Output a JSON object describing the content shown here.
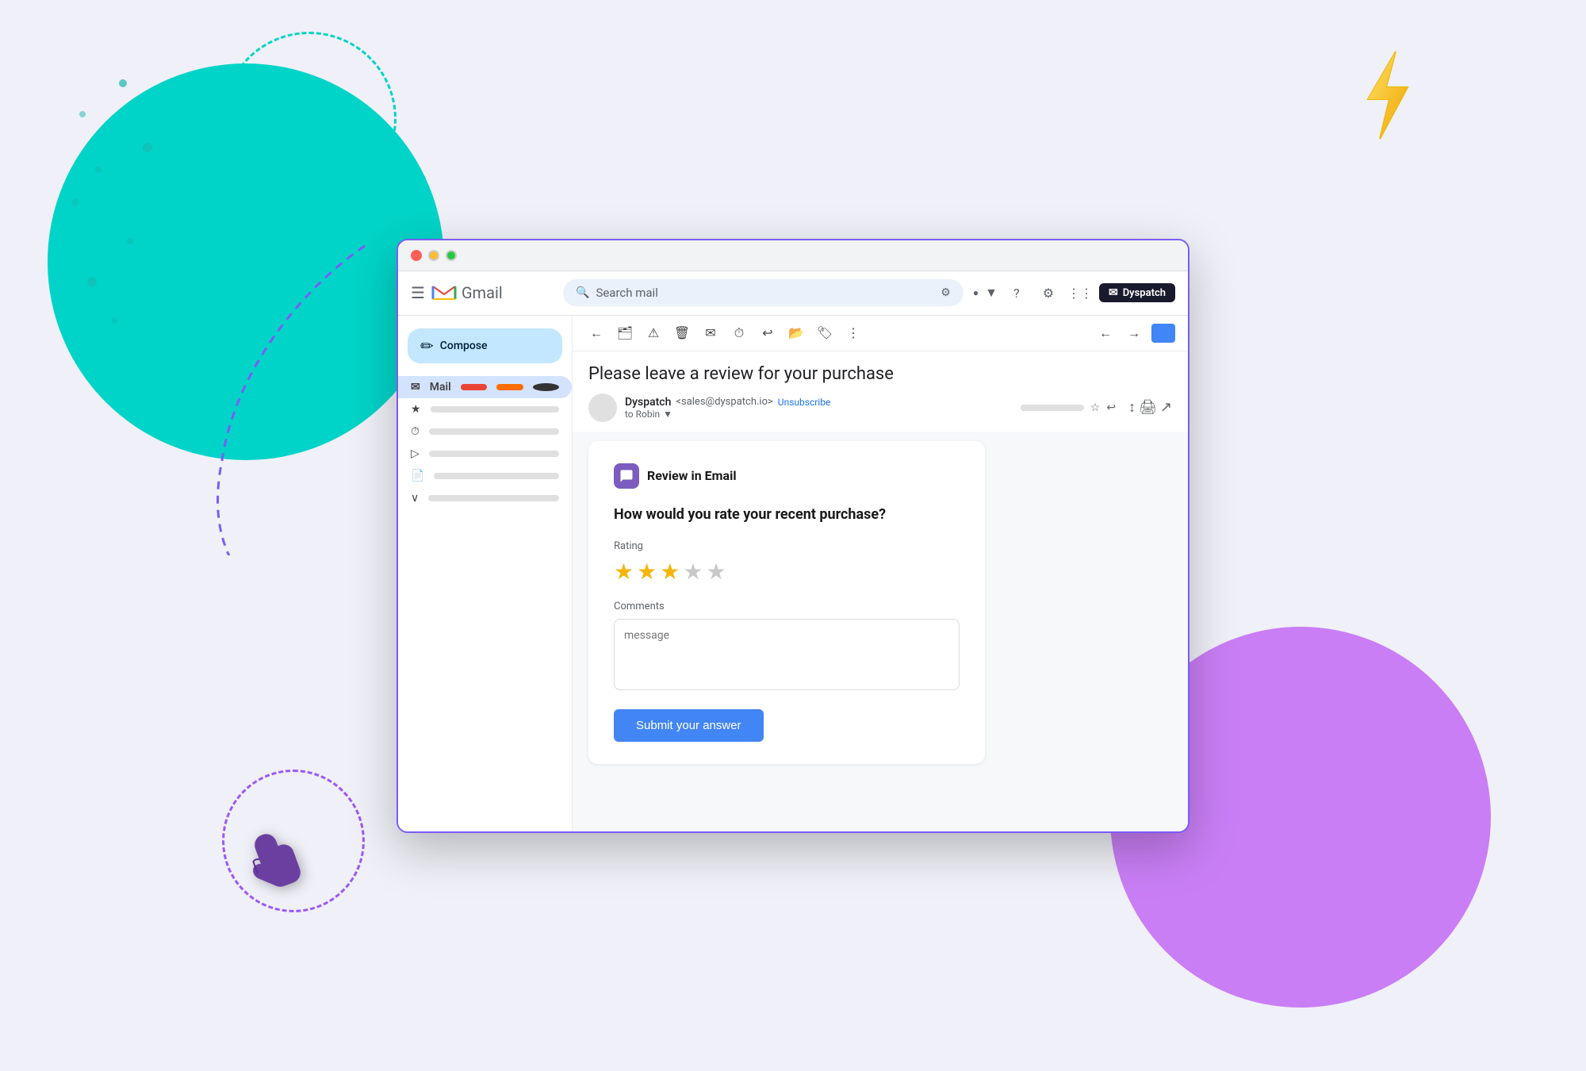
{
  "background": {
    "blob_teal_color": "#00d4c8",
    "blob_purple_color": "#c97ef5"
  },
  "browser": {
    "traffic_lights": [
      "red",
      "yellow",
      "green"
    ],
    "border_color": "#7b5cf5"
  },
  "gmail": {
    "header": {
      "logo_text": "Gmail",
      "search_placeholder": "Search mail",
      "filter_icon": "⚙",
      "settings_icon": "⚙",
      "apps_icon": "⋮⋮",
      "dyspatch_label": "Dyspatch"
    },
    "sidebar": {
      "compose_label": "Compose",
      "mail_label": "Mail",
      "items": [
        {
          "icon": "★",
          "label": ""
        },
        {
          "icon": "⏱",
          "label": ""
        },
        {
          "icon": "▷",
          "label": ""
        },
        {
          "icon": "📄",
          "label": ""
        },
        {
          "icon": "∨",
          "label": ""
        }
      ]
    },
    "toolbar_icons": [
      "←",
      "→",
      "🗑",
      "✉",
      "⏱",
      "↩",
      "📂",
      "🏷",
      "⋮",
      "↑",
      "↓",
      "🖨",
      "↗"
    ],
    "email": {
      "subject": "Please leave a review for your purchase",
      "sender_name": "Dyspatch",
      "sender_email": "sales@dyspatch.io",
      "unsubscribe_text": "Unsubscribe",
      "to": "to Robin"
    },
    "review_card": {
      "icon": "💬",
      "title": "Review in Email",
      "question": "How would you rate your recent purchase?",
      "rating_label": "Rating",
      "stars": [
        {
          "filled": true
        },
        {
          "filled": true
        },
        {
          "filled": true
        },
        {
          "filled": false
        },
        {
          "filled": false
        }
      ],
      "comments_label": "Comments",
      "comments_placeholder": "message",
      "submit_button_label": "Submit your answer"
    }
  },
  "decorations": {
    "hand_emoji": "👆",
    "lightning_emoji": "⚡"
  }
}
